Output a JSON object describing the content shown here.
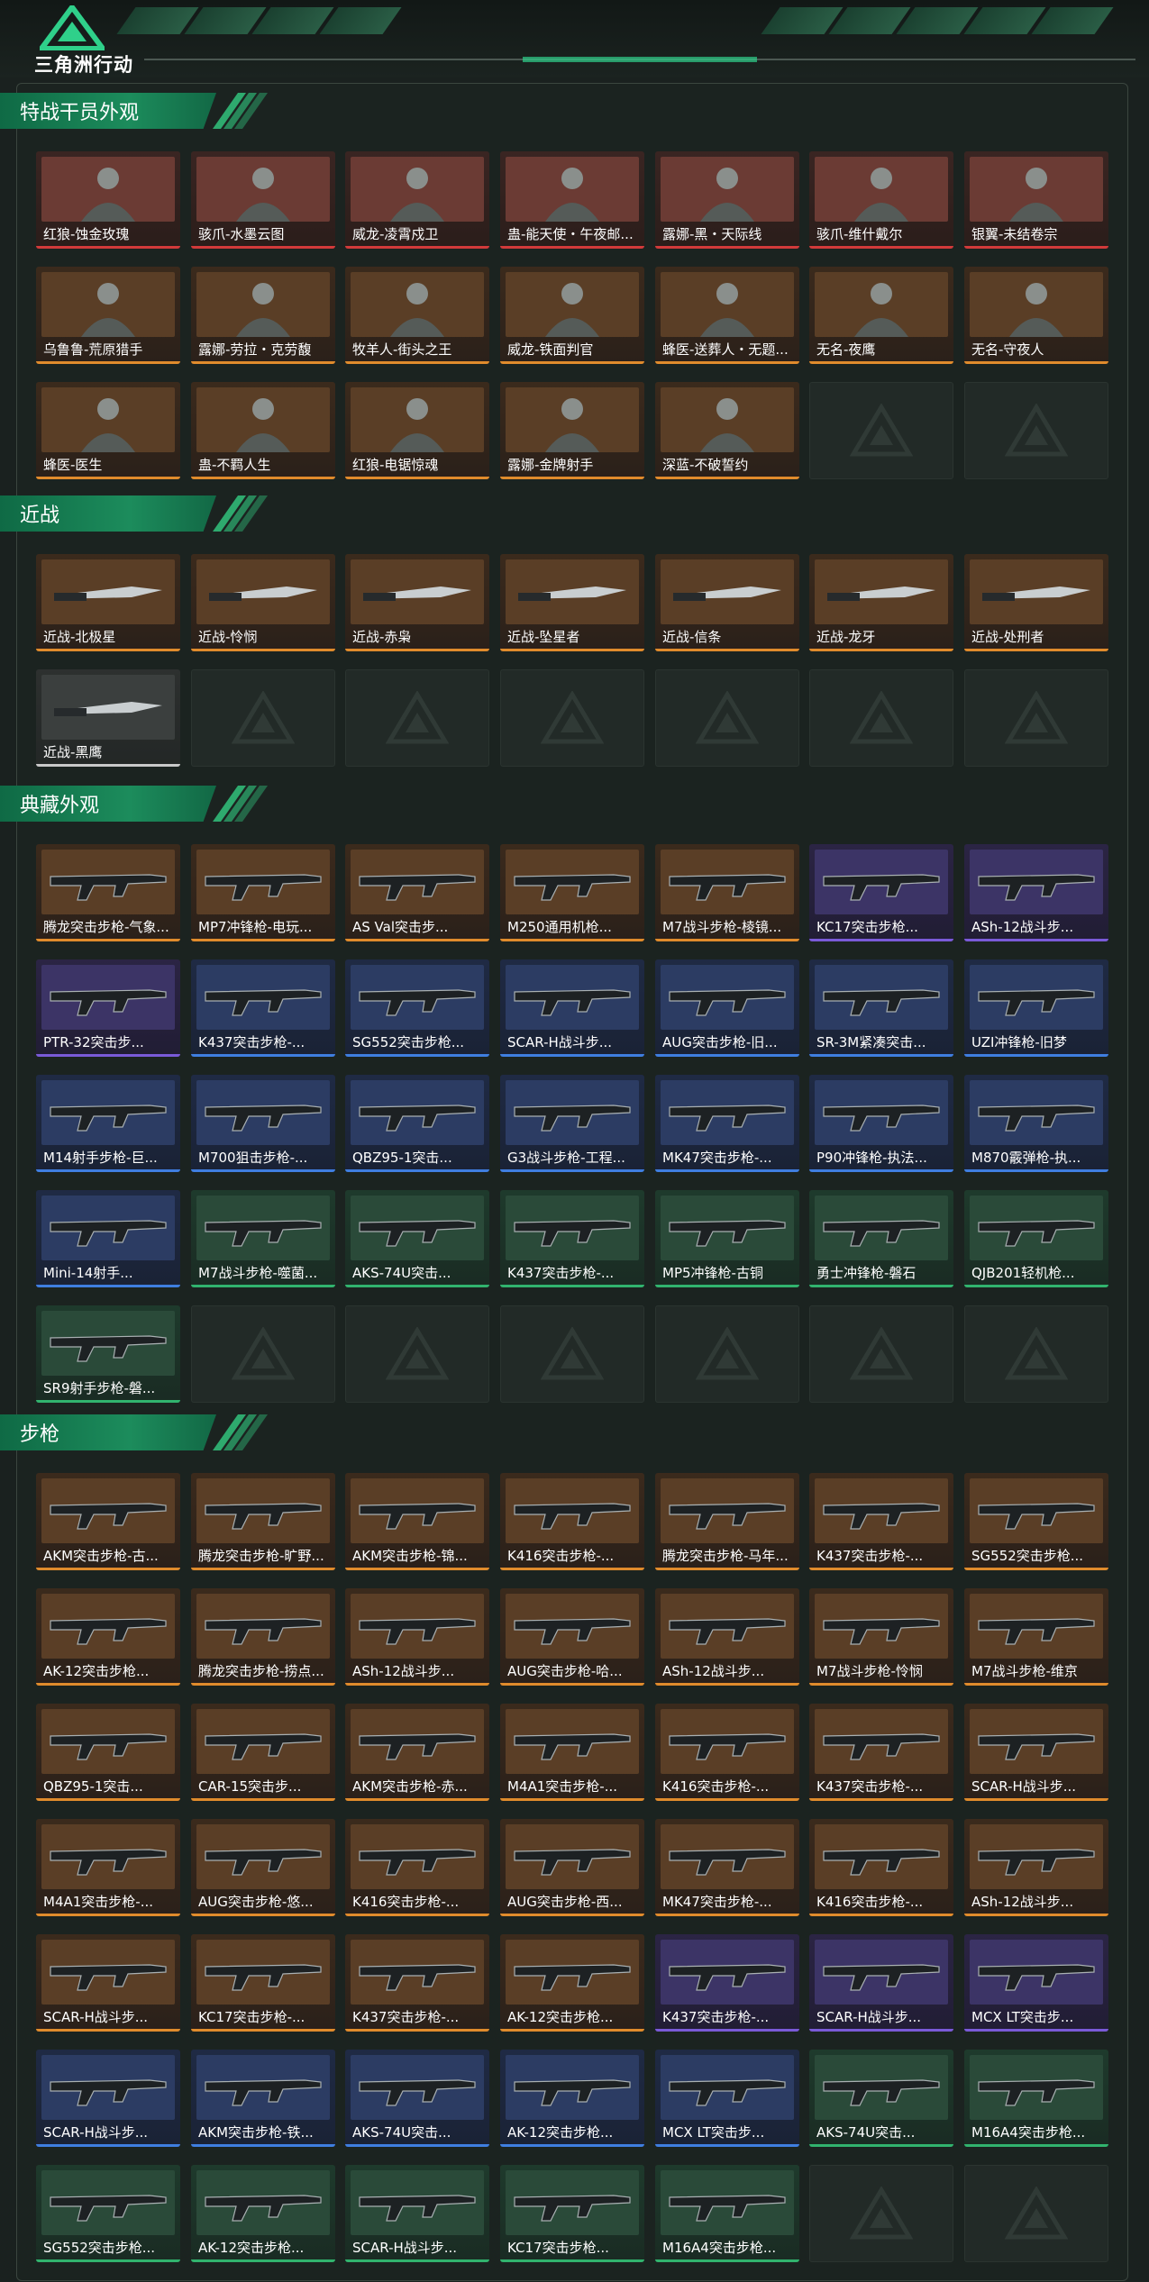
{
  "app": {
    "logo_text": "三角洲行动",
    "accent_color": "#1c8c5c",
    "rarity_colors": {
      "red": "#d23a3a",
      "gold": "#e08b2c",
      "purple": "#7a5ad8",
      "blue": "#3f7ee0",
      "green": "#31b36e",
      "white": "#c9c9c9"
    }
  },
  "sections": [
    {
      "title": "特战干员外观",
      "empty_slots": 2,
      "items": [
        {
          "name": "红狼-蚀金玫瑰",
          "rarity": "red"
        },
        {
          "name": "骇爪-水墨云图",
          "rarity": "red"
        },
        {
          "name": "威龙-凌霄戍卫",
          "rarity": "red"
        },
        {
          "name": "蛊-能天使・午夜邮...",
          "rarity": "red"
        },
        {
          "name": "露娜-黑・天际线",
          "rarity": "red"
        },
        {
          "name": "骇爪-维什戴尔",
          "rarity": "red"
        },
        {
          "name": "银翼-未结卷宗",
          "rarity": "red"
        },
        {
          "name": "乌鲁鲁-荒原猎手",
          "rarity": "gold"
        },
        {
          "name": "露娜-劳拉・克劳馥",
          "rarity": "gold"
        },
        {
          "name": "牧羊人-街头之王",
          "rarity": "gold"
        },
        {
          "name": "威龙-铁面判官",
          "rarity": "gold"
        },
        {
          "name": "蜂医-送葬人・无题...",
          "rarity": "gold"
        },
        {
          "name": "无名-夜鹰",
          "rarity": "gold"
        },
        {
          "name": "无名-守夜人",
          "rarity": "gold"
        },
        {
          "name": "蜂医-医生",
          "rarity": "gold"
        },
        {
          "name": "蛊-不羁人生",
          "rarity": "gold"
        },
        {
          "name": "红狼-电锯惊魂",
          "rarity": "gold"
        },
        {
          "name": "露娜-金牌射手",
          "rarity": "gold"
        },
        {
          "name": "深蓝-不破誓约",
          "rarity": "gold"
        }
      ]
    },
    {
      "title": "近战",
      "empty_slots": 6,
      "items": [
        {
          "name": "近战-北极星",
          "rarity": "gold"
        },
        {
          "name": "近战-怜悯",
          "rarity": "gold"
        },
        {
          "name": "近战-赤枭",
          "rarity": "gold"
        },
        {
          "name": "近战-坠星者",
          "rarity": "gold"
        },
        {
          "name": "近战-信条",
          "rarity": "gold"
        },
        {
          "name": "近战-龙牙",
          "rarity": "gold"
        },
        {
          "name": "近战-处刑者",
          "rarity": "gold"
        },
        {
          "name": "近战-黑鹰",
          "rarity": "white"
        }
      ]
    },
    {
      "title": "典藏外观",
      "empty_slots": 6,
      "items": [
        {
          "name": "腾龙突击步枪-气象...",
          "rarity": "gold"
        },
        {
          "name": "MP7冲锋枪-电玩...",
          "rarity": "gold"
        },
        {
          "name": "AS Val突击步...",
          "rarity": "gold"
        },
        {
          "name": "M250通用机枪...",
          "rarity": "gold"
        },
        {
          "name": "M7战斗步枪-棱镜...",
          "rarity": "gold"
        },
        {
          "name": "KC17突击步枪...",
          "rarity": "purple"
        },
        {
          "name": "ASh-12战斗步...",
          "rarity": "purple"
        },
        {
          "name": "PTR-32突击步...",
          "rarity": "purple"
        },
        {
          "name": "K437突击步枪-...",
          "rarity": "blue"
        },
        {
          "name": "SG552突击步枪...",
          "rarity": "blue"
        },
        {
          "name": "SCAR-H战斗步...",
          "rarity": "blue"
        },
        {
          "name": "AUG突击步枪-旧...",
          "rarity": "blue"
        },
        {
          "name": "SR-3M紧凑突击...",
          "rarity": "blue"
        },
        {
          "name": "UZI冲锋枪-旧梦",
          "rarity": "blue"
        },
        {
          "name": "M14射手步枪-巨...",
          "rarity": "blue"
        },
        {
          "name": "M700狙击步枪-...",
          "rarity": "blue"
        },
        {
          "name": "QBZ95-1突击...",
          "rarity": "blue"
        },
        {
          "name": "G3战斗步枪-工程...",
          "rarity": "blue"
        },
        {
          "name": "MK47突击步枪-...",
          "rarity": "blue"
        },
        {
          "name": "P90冲锋枪-执法...",
          "rarity": "blue"
        },
        {
          "name": "M870霰弹枪-执...",
          "rarity": "blue"
        },
        {
          "name": "Mini-14射手...",
          "rarity": "blue"
        },
        {
          "name": "M7战斗步枪-噬菌...",
          "rarity": "green"
        },
        {
          "name": "AKS-74U突击...",
          "rarity": "green"
        },
        {
          "name": "K437突击步枪-...",
          "rarity": "green"
        },
        {
          "name": "MP5冲锋枪-古铜",
          "rarity": "green"
        },
        {
          "name": "勇士冲锋枪-磐石",
          "rarity": "green"
        },
        {
          "name": "QJB201轻机枪...",
          "rarity": "green"
        },
        {
          "name": "SR9射手步枪-磐...",
          "rarity": "green"
        }
      ]
    },
    {
      "title": "步枪",
      "empty_slots": 2,
      "items": [
        {
          "name": "AKM突击步枪-古...",
          "rarity": "gold"
        },
        {
          "name": "腾龙突击步枪-旷野...",
          "rarity": "gold"
        },
        {
          "name": "AKM突击步枪-锦...",
          "rarity": "gold"
        },
        {
          "name": "K416突击步枪-...",
          "rarity": "gold"
        },
        {
          "name": "腾龙突击步枪-马年...",
          "rarity": "gold"
        },
        {
          "name": "K437突击步枪-...",
          "rarity": "gold"
        },
        {
          "name": "SG552突击步枪...",
          "rarity": "gold"
        },
        {
          "name": "AK-12突击步枪...",
          "rarity": "gold"
        },
        {
          "name": "腾龙突击步枪-捞点...",
          "rarity": "gold"
        },
        {
          "name": "ASh-12战斗步...",
          "rarity": "gold"
        },
        {
          "name": "AUG突击步枪-哈...",
          "rarity": "gold"
        },
        {
          "name": "ASh-12战斗步...",
          "rarity": "gold"
        },
        {
          "name": "M7战斗步枪-怜悯",
          "rarity": "gold"
        },
        {
          "name": "M7战斗步枪-维京",
          "rarity": "gold"
        },
        {
          "name": "QBZ95-1突击...",
          "rarity": "gold"
        },
        {
          "name": "CAR-15突击步...",
          "rarity": "gold"
        },
        {
          "name": "AKM突击步枪-赤...",
          "rarity": "gold"
        },
        {
          "name": "M4A1突击步枪-...",
          "rarity": "gold"
        },
        {
          "name": "K416突击步枪-...",
          "rarity": "gold"
        },
        {
          "name": "K437突击步枪-...",
          "rarity": "gold"
        },
        {
          "name": "SCAR-H战斗步...",
          "rarity": "gold"
        },
        {
          "name": "M4A1突击步枪-...",
          "rarity": "gold"
        },
        {
          "name": "AUG突击步枪-悠...",
          "rarity": "gold"
        },
        {
          "name": "K416突击步枪-...",
          "rarity": "gold"
        },
        {
          "name": "AUG突击步枪-西...",
          "rarity": "gold"
        },
        {
          "name": "MK47突击步枪-...",
          "rarity": "gold"
        },
        {
          "name": "K416突击步枪-...",
          "rarity": "gold"
        },
        {
          "name": "ASh-12战斗步...",
          "rarity": "gold"
        },
        {
          "name": "SCAR-H战斗步...",
          "rarity": "gold"
        },
        {
          "name": "KC17突击步枪-...",
          "rarity": "gold"
        },
        {
          "name": "K437突击步枪-...",
          "rarity": "gold"
        },
        {
          "name": "AK-12突击步枪...",
          "rarity": "gold"
        },
        {
          "name": "K437突击步枪-...",
          "rarity": "purple"
        },
        {
          "name": "SCAR-H战斗步...",
          "rarity": "purple"
        },
        {
          "name": "MCX LT突击步...",
          "rarity": "purple"
        },
        {
          "name": "SCAR-H战斗步...",
          "rarity": "blue"
        },
        {
          "name": "AKM突击步枪-铁...",
          "rarity": "blue"
        },
        {
          "name": "AKS-74U突击...",
          "rarity": "blue"
        },
        {
          "name": "AK-12突击步枪...",
          "rarity": "blue"
        },
        {
          "name": "MCX LT突击步...",
          "rarity": "blue"
        },
        {
          "name": "AKS-74U突击...",
          "rarity": "green"
        },
        {
          "name": "M16A4突击步枪...",
          "rarity": "green"
        },
        {
          "name": "SG552突击步枪...",
          "rarity": "green"
        },
        {
          "name": "AK-12突击步枪...",
          "rarity": "green"
        },
        {
          "name": "SCAR-H战斗步...",
          "rarity": "green"
        },
        {
          "name": "KC17突击步枪...",
          "rarity": "green"
        },
        {
          "name": "M16A4突击步枪...",
          "rarity": "green"
        }
      ]
    }
  ]
}
